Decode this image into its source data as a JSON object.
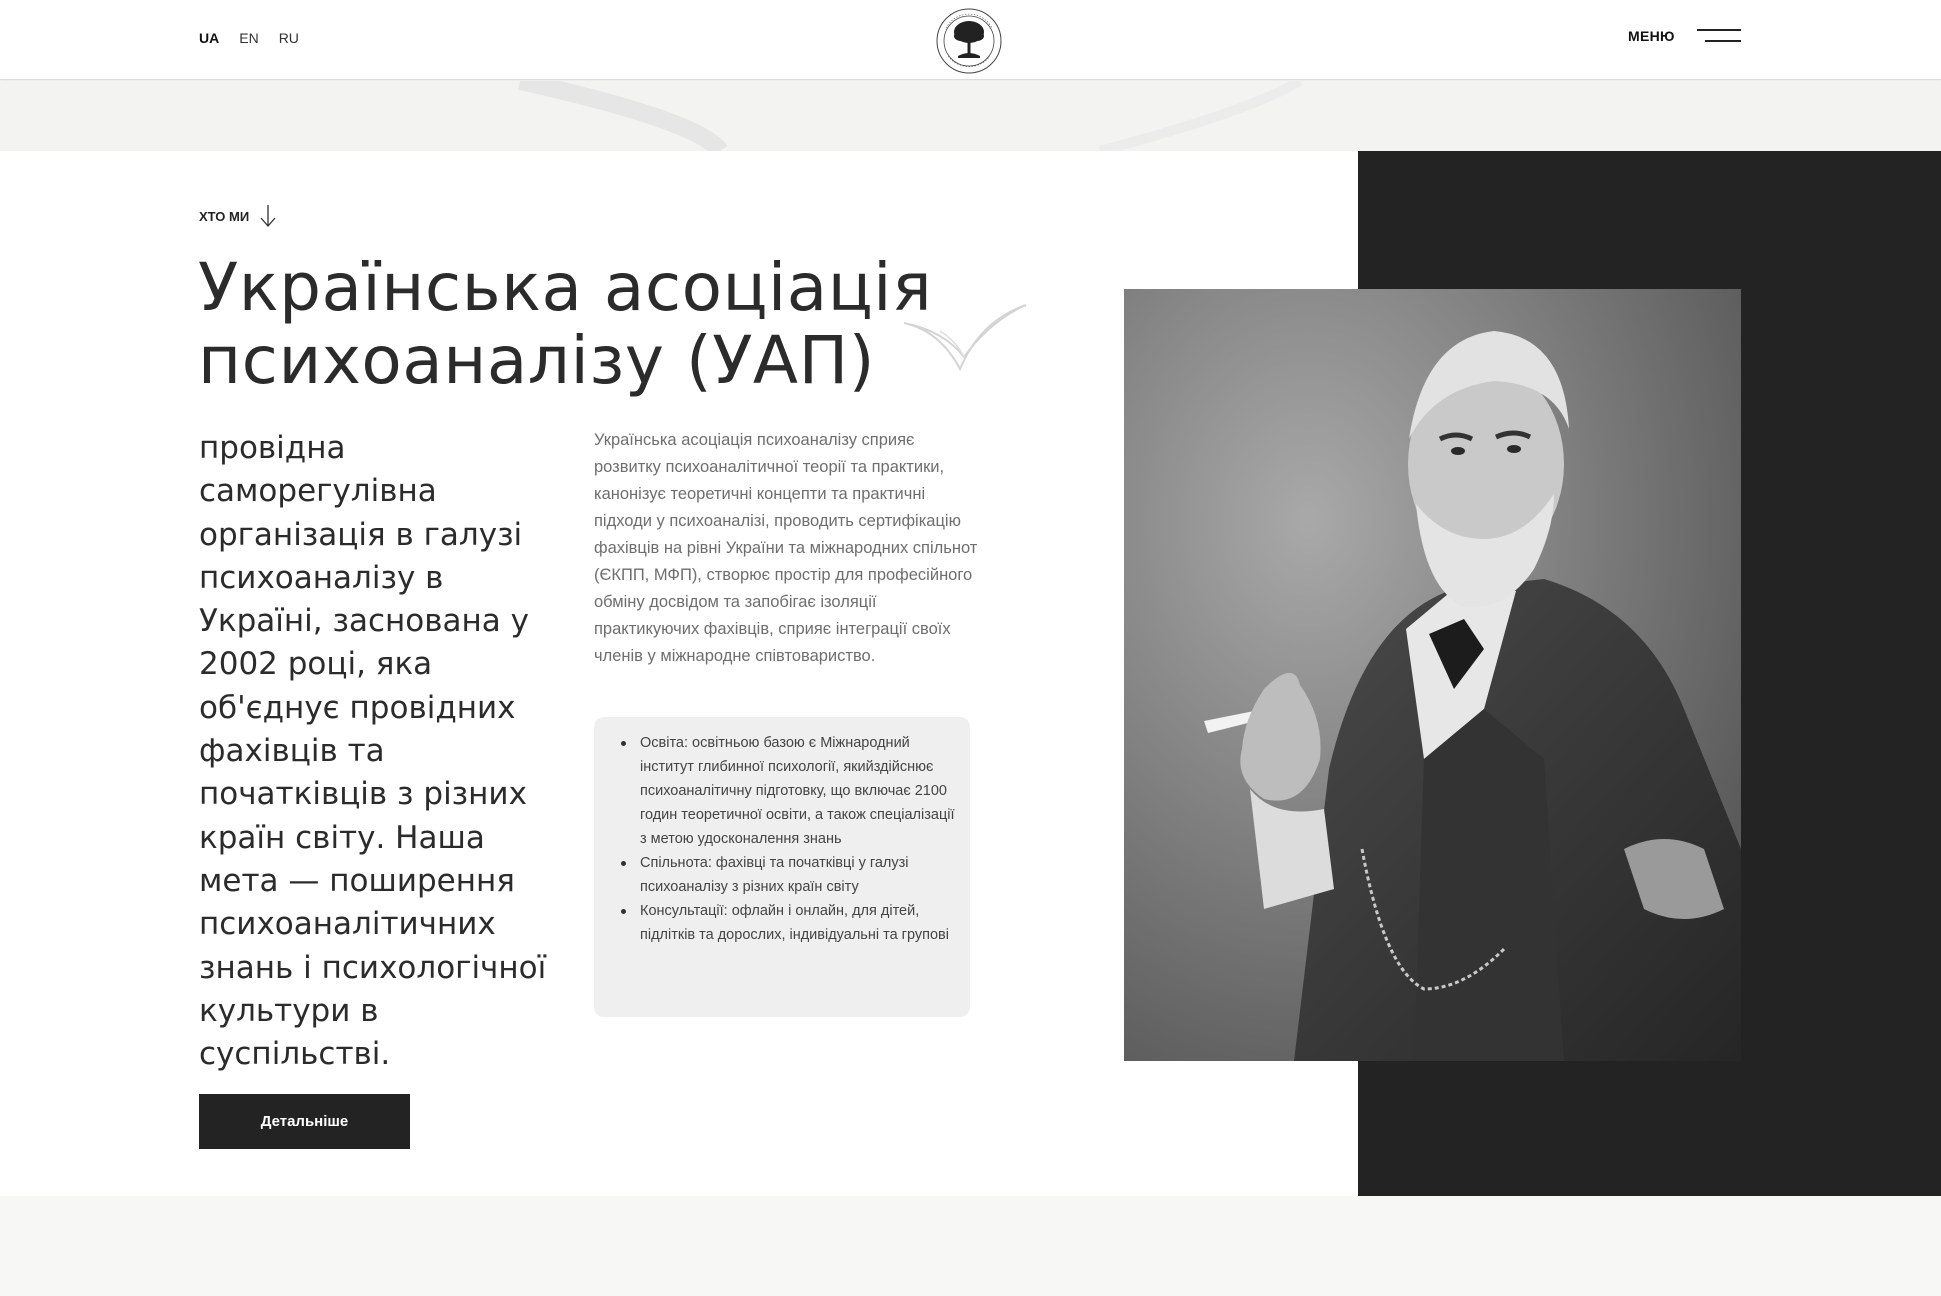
{
  "header": {
    "languages": [
      "UA",
      "EN",
      "RU"
    ],
    "active_language": "UA",
    "logo_icon": "tree-seal-logo",
    "menu_label": "МЕНЮ",
    "menu_icon": "burger-icon"
  },
  "hero": {
    "eyebrow": "ХТО МИ",
    "eyebrow_icon": "arrow-down-icon",
    "title": "Українська асоціація психоаналізу (УАП)",
    "lead": "провідна саморегулівна організація в галузі психоаналізу в Україні, заснована у 2002 році, яка об'єднує провідних фахівців та початківців з різних країн світу. Наша мета — поширення психоаналітичних знань і психологічної культури в суспільстві.",
    "description": "Українська асоціація психоаналізу сприяє розвитку психоаналітичної теорії та практики, канонізує теоретичні концепти та практичні підходи у психоаналізі, проводить сертифікацію фахівців на рівні України та міжнародних спільнот (ЄКПП, МФП), створює простір для професійного обміну досвідом та запобігає ізоляції практикуючих фахівців, сприяє інтеграції своїх членів у міжнародне співтовариство.",
    "bullets": [
      "Освіта: освітньою базою є Міжнародний інститут глибинної психології, якийздійснює психоаналітичну підготовку, що включає 2100 годин теоретичної освіти, а також спеціалізації з метою удосконалення знань",
      "Спільнота: фахівці та початківці у галузі психоаналізу з різних країн світу",
      "Консультації: офлайн і онлайн, для дітей, підлітків та дорослих, індивідуальні та групові"
    ],
    "button_label": "Детальніше",
    "photo": "portrait-photo"
  },
  "colors": {
    "dark": "#232323",
    "background": "#ffffff",
    "muted_text": "#6e6e6e",
    "box_bg": "#efefef"
  }
}
